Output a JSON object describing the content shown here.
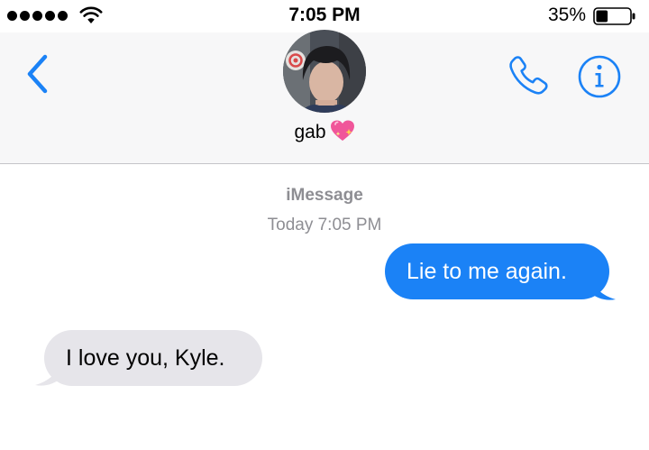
{
  "status_bar": {
    "time": "7:05 PM",
    "battery_percent": "35%",
    "battery_level": 0.35
  },
  "header": {
    "contact_name": "gab",
    "name_emoji_icon": "sparkling-heart-icon",
    "back_icon": "chevron-left-icon",
    "call_icon": "phone-icon",
    "info_icon": "info-icon"
  },
  "conversation": {
    "service": "iMessage",
    "timestamp": "Today 7:05 PM",
    "messages": [
      {
        "direction": "outgoing",
        "text": "Lie to me again."
      },
      {
        "direction": "incoming",
        "text": "I love you, Kyle."
      }
    ]
  },
  "colors": {
    "accent": "#1b82f6",
    "incoming_bubble": "#e6e5ea",
    "secondary_text": "#8e8e93",
    "header_background": "#f7f7f8"
  }
}
